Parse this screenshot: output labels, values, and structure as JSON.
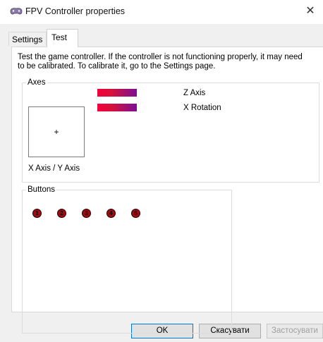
{
  "window": {
    "title": "FPV Controller properties",
    "close_glyph": "✕"
  },
  "tabs": [
    {
      "label": "Settings",
      "active": false
    },
    {
      "label": "Test",
      "active": true
    }
  ],
  "description": "Test the game controller.  If the controller is not functioning properly, it may need\nto be calibrated.  To calibrate it, go to the Settings page.",
  "axes": {
    "group_label": "Axes",
    "crosshair": "+",
    "xy_label": "X Axis / Y Axis",
    "z_label": "Z Axis",
    "x_rotation_label": "X Rotation"
  },
  "buttons": {
    "group_label": "Buttons",
    "items": [
      "1",
      "2",
      "3",
      "4",
      "5"
    ]
  },
  "dialog_buttons": {
    "ok": "OK",
    "cancel": "Скасувати",
    "apply": "Застосувати"
  },
  "colors": {
    "bar_start": "#f2003c",
    "bar_end": "#7a0f96",
    "button_fill": "#9c0c10"
  }
}
